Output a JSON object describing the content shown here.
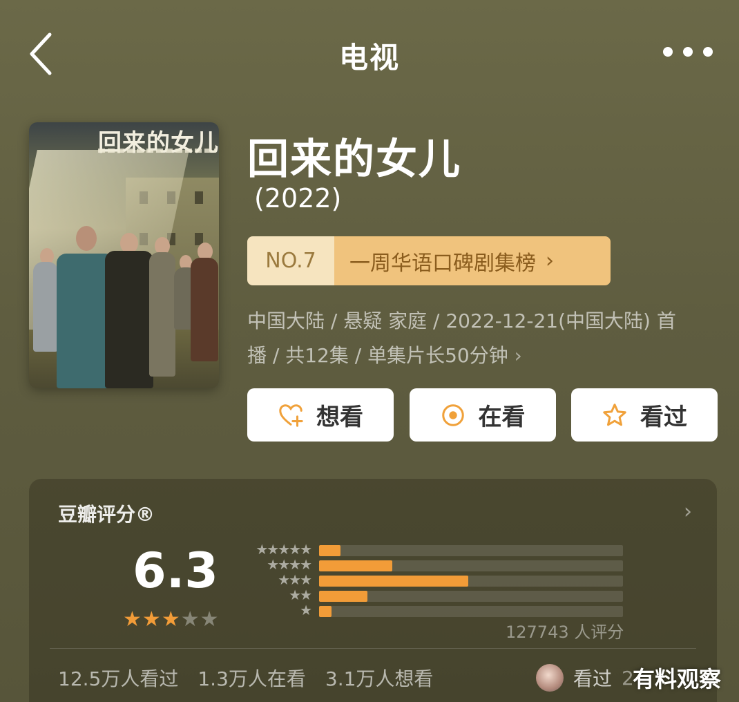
{
  "nav": {
    "title": "电视"
  },
  "poster": {
    "title": "回来的女儿"
  },
  "show": {
    "title": "回来的女儿",
    "year": "(2022)",
    "rank_no": "NO.7",
    "rank_label": "一周华语口碑剧集榜",
    "meta_line1": "中国大陆 / 悬疑 家庭 / 2022-12-21(中国大陆) 首",
    "meta_line2": "播 / 共12集 / 单集片长50分钟"
  },
  "actions": [
    {
      "label": "想看",
      "icon": "heart-plus-icon"
    },
    {
      "label": "在看",
      "icon": "target-icon"
    },
    {
      "label": "看过",
      "icon": "star-outline-icon"
    }
  ],
  "rating": {
    "title": "豆瓣评分®",
    "score": "6.3",
    "score_stars_filled": 3,
    "score_stars_total": 5,
    "rows": [
      {
        "stars": "★★★★★",
        "fraction": 0.07
      },
      {
        "stars": "★★★★",
        "fraction": 0.24
      },
      {
        "stars": "★★★",
        "fraction": 0.49
      },
      {
        "stars": "★★",
        "fraction": 0.16
      },
      {
        "stars": "★",
        "fraction": 0.04
      }
    ],
    "count": "127743 人评分",
    "stats": [
      "12.5万人看过",
      "1.3万人在看",
      "3.1万人想看"
    ],
    "friend_label": "看过",
    "friend_tail": "2"
  },
  "watermark": "有料观察",
  "colors": {
    "accent": "#f29c38",
    "rank_bg": "#f0c37d",
    "icon_orange": "#f0a13a"
  }
}
